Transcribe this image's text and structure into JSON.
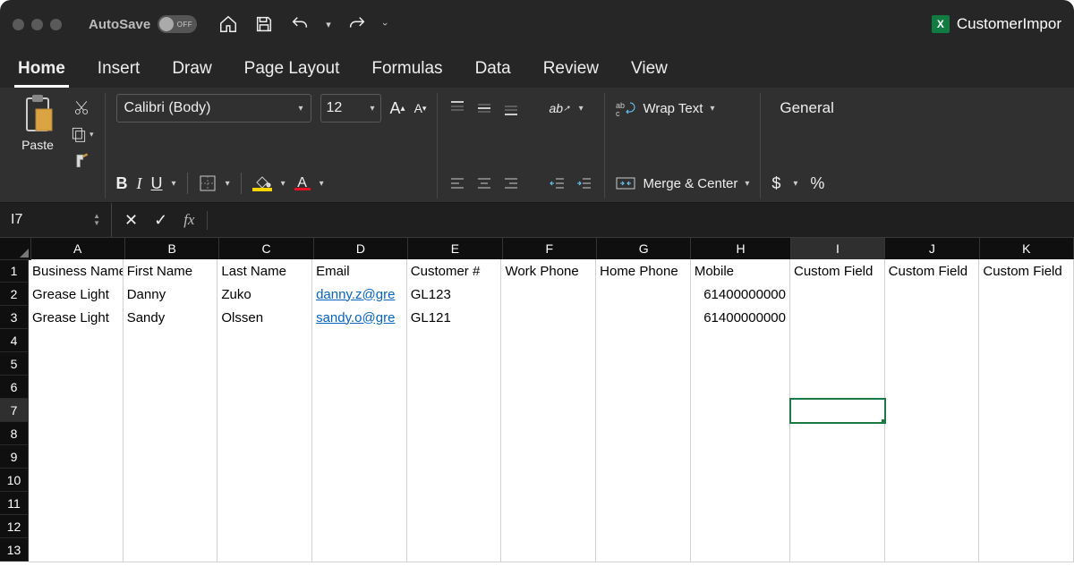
{
  "titlebar": {
    "autosave_label": "AutoSave",
    "autosave_state": "OFF",
    "filename": "CustomerImpor"
  },
  "tabs": [
    "Home",
    "Insert",
    "Draw",
    "Page Layout",
    "Formulas",
    "Data",
    "Review",
    "View"
  ],
  "ribbon": {
    "paste": "Paste",
    "font_name": "Calibri (Body)",
    "font_size": "12",
    "wrap_text": "Wrap Text",
    "merge_center": "Merge & Center",
    "number_format": "General"
  },
  "namebox": {
    "cell_ref": "I7",
    "formula": ""
  },
  "columns": [
    "A",
    "B",
    "C",
    "D",
    "E",
    "F",
    "G",
    "H",
    "I",
    "J",
    "K"
  ],
  "row_count": 13,
  "selected": {
    "row": 7,
    "col": "I",
    "colIndex": 8
  },
  "data": {
    "1": {
      "A": "Business Name",
      "B": "First Name",
      "C": "Last Name",
      "D": "Email",
      "E": "Customer #",
      "F": "Work Phone",
      "G": "Home Phone",
      "H": "Mobile",
      "I": "Custom Field",
      "J": "Custom Field",
      "K": "Custom Field"
    },
    "2": {
      "A": "Grease Light",
      "B": "Danny",
      "C": "Zuko",
      "D": "danny.z@gre",
      "E": "GL123",
      "F": "",
      "G": "",
      "H": "61400000000",
      "I": "",
      "J": "",
      "K": ""
    },
    "3": {
      "A": "Grease Light",
      "B": "Sandy",
      "C": "Olssen",
      "D": "sandy.o@gre",
      "E": "GL121",
      "F": "",
      "G": "",
      "H": "61400000000",
      "I": "",
      "J": "",
      "K": ""
    }
  },
  "link_cells": [
    "2.D",
    "3.D"
  ],
  "numeric_cols": [
    "H"
  ]
}
